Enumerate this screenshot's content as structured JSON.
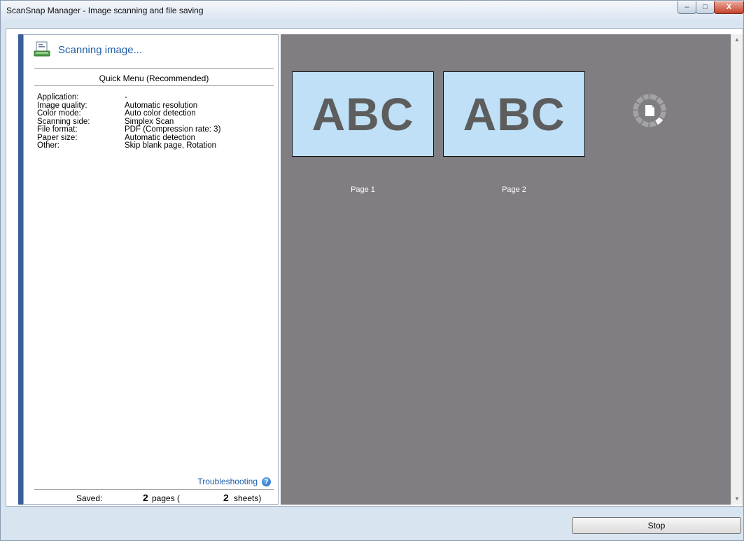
{
  "window": {
    "title": "ScanSnap Manager - Image scanning and file saving",
    "controls": {
      "minimize": "–",
      "maximize": "□",
      "close": "X"
    }
  },
  "status": {
    "icon": "scanner-document-icon",
    "text": "Scanning image..."
  },
  "quick_menu": {
    "title": "Quick Menu (Recommended)"
  },
  "settings": [
    {
      "label": "Application:",
      "value": "-"
    },
    {
      "label": "Image quality:",
      "value": "Automatic resolution"
    },
    {
      "label": "Color mode:",
      "value": "Auto color detection"
    },
    {
      "label": "Scanning side:",
      "value": "Simplex Scan"
    },
    {
      "label": "File format:",
      "value": "PDF (Compression rate: 3)"
    },
    {
      "label": "Paper size:",
      "value": "Automatic detection"
    },
    {
      "label": "Other:",
      "value": "Skip blank page, Rotation"
    }
  ],
  "troubleshooting": {
    "label": "Troubleshooting",
    "icon": "help-icon"
  },
  "saved": {
    "label": "Saved:",
    "pages_count": "2",
    "pages_text": "pages (",
    "sheets_count": "2",
    "sheets_text": "sheets)"
  },
  "preview": {
    "pages": [
      {
        "text": "ABC",
        "label": "Page 1"
      },
      {
        "text": "ABC",
        "label": "Page 2"
      }
    ],
    "spinner_icon": "loading-spinner-icon"
  },
  "footer": {
    "stop_label": "Stop"
  },
  "colors": {
    "accent": "#1f5ca8",
    "preview_bg": "#807e82",
    "thumb_bg": "#bfe0f6",
    "left_accent": "#3b5e9a"
  }
}
